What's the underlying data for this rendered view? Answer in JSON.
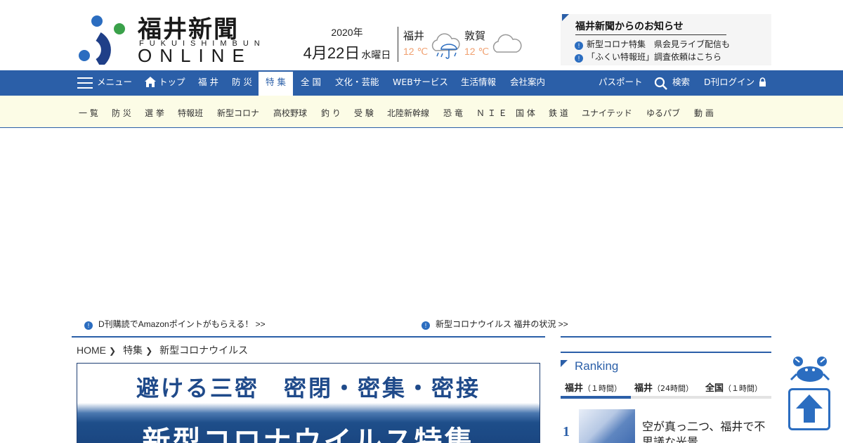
{
  "header": {
    "logo": {
      "jp": "福井新聞",
      "romaji": "FUKUISHIMBUN",
      "online": "ONLINE"
    },
    "date": {
      "year": "2020年",
      "month_day": "4月22日",
      "weekday": "水曜日"
    },
    "weather": [
      {
        "city": "福井",
        "temp": "12 ℃",
        "icon": "rain-cloud-umbrella-icon"
      },
      {
        "city": "敦賀",
        "temp": "12 ℃",
        "icon": "cloud-icon"
      }
    ],
    "notice": {
      "title": "福井新聞からのお知らせ",
      "items": [
        "新型コロナ特集　県会見ライブ配信も",
        "「ふくい特報班」調査依頼はこちら"
      ]
    }
  },
  "nav": {
    "menu_label": "メニュー",
    "items": [
      "トップ",
      "福 井",
      "防 災",
      "特 集",
      "全 国",
      "文化・芸能",
      "WEBサービス",
      "生活情報",
      "会社案内"
    ],
    "active": "特 集",
    "right": {
      "passport": "パスポート",
      "search": "検索",
      "login": "D刊ログイン"
    }
  },
  "subnav": {
    "items": [
      "一 覧",
      "防 災",
      "選 挙",
      "特報班",
      "新型コロナ",
      "高校野球",
      "釣 り",
      "受 験",
      "北陸新幹線",
      "恐 竜",
      "Ｎ Ｉ Ｅ",
      "国 体",
      "鉄 道",
      "ユナイテッド",
      "ゆるパブ",
      "動 画"
    ]
  },
  "promos": [
    "D刊購読でAmazonポイントがもらえる！ >>",
    "新型コロナウイルス 福井の状況 >>"
  ],
  "breadcrumb": [
    "HOME",
    "特集",
    "新型コロナウイルス"
  ],
  "banner": {
    "line1": "避ける三密　密閉・密集・密接",
    "line2": "新型コロナウイルス特集"
  },
  "ranking": {
    "title": "Ranking",
    "tabs": [
      {
        "name": "福井",
        "period": "（１時間）"
      },
      {
        "name": "福井",
        "period": "（24時間）"
      },
      {
        "name": "全国",
        "period": "（１時間）"
      }
    ],
    "items": [
      {
        "rank": "1",
        "text": "空が真っ二つ、福井で不思議な光景"
      }
    ]
  },
  "colors": {
    "brand_blue": "#2b5fa8",
    "subnav_bg": "#fcfce6",
    "temp_orange": "#f0a070",
    "logo_green": "#3aa14a"
  }
}
